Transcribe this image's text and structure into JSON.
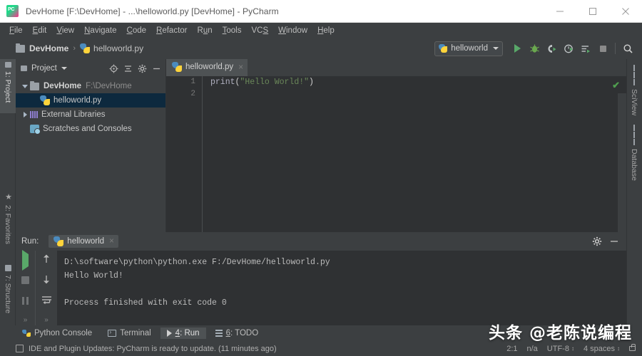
{
  "window": {
    "title": "DevHome [F:\\DevHome] - ...\\helloworld.py [DevHome] - PyCharm",
    "logo_icon": "pycharm-logo-icon",
    "minimize_icon": "minimize-icon",
    "maximize_icon": "maximize-icon",
    "close_icon": "close-icon"
  },
  "menubar": {
    "items": [
      {
        "label": "File",
        "mnemonic": "F"
      },
      {
        "label": "Edit",
        "mnemonic": "E"
      },
      {
        "label": "View",
        "mnemonic": "V"
      },
      {
        "label": "Navigate",
        "mnemonic": "N"
      },
      {
        "label": "Code",
        "mnemonic": "C"
      },
      {
        "label": "Refactor",
        "mnemonic": "R"
      },
      {
        "label": "Run",
        "mnemonic": "u"
      },
      {
        "label": "Tools",
        "mnemonic": "T"
      },
      {
        "label": "VCS",
        "mnemonic": "S"
      },
      {
        "label": "Window",
        "mnemonic": "W"
      },
      {
        "label": "Help",
        "mnemonic": "H"
      }
    ]
  },
  "navbar": {
    "breadcrumb": [
      {
        "label": "DevHome",
        "icon": "folder-icon"
      },
      {
        "label": "helloworld.py",
        "icon": "python-file-icon"
      }
    ],
    "separator": "›",
    "run_config": {
      "label": "helloworld",
      "icon": "python-file-icon",
      "caret": "chevron-down-icon"
    },
    "buttons": [
      {
        "name": "run-button",
        "icon": "run-triangle-icon"
      },
      {
        "name": "debug-button",
        "icon": "bug-icon"
      },
      {
        "name": "run-with-coverage-button",
        "icon": "coverage-icon"
      },
      {
        "name": "profile-button",
        "icon": "profile-clock-icon"
      },
      {
        "name": "run-with-console-button",
        "icon": "run-console-icon"
      },
      {
        "name": "stop-button",
        "icon": "stop-square-icon"
      },
      {
        "name": "search-everywhere-button",
        "icon": "search-icon"
      }
    ]
  },
  "left_strip": {
    "tabs": [
      {
        "label": "1: Project",
        "icon": "project-icon",
        "active": true
      },
      {
        "label": "2: Favorites",
        "icon": "star-icon",
        "active": false
      },
      {
        "label": "7: Structure",
        "icon": "structure-icon",
        "active": false
      }
    ]
  },
  "right_strip": {
    "tabs": [
      {
        "label": "SciView",
        "icon": "sciview-icon"
      },
      {
        "label": "Database",
        "icon": "database-icon"
      }
    ]
  },
  "project_panel": {
    "title": "Project",
    "title_caret": "chevron-down-icon",
    "header_icons": [
      {
        "name": "locate-icon"
      },
      {
        "name": "collapse-all-icon"
      },
      {
        "name": "settings-gear-icon"
      },
      {
        "name": "hide-icon"
      }
    ],
    "tree": [
      {
        "label": "DevHome",
        "detail": "F:\\DevHome",
        "icon": "folder-icon",
        "twisty": "expanded",
        "bold": true,
        "selected": false
      },
      {
        "label": "helloworld.py",
        "detail": "",
        "icon": "python-file-icon",
        "twisty": "none",
        "bold": false,
        "selected": true
      },
      {
        "label": "External Libraries",
        "detail": "",
        "icon": "library-icon",
        "twisty": "collapsed",
        "bold": false,
        "selected": false
      },
      {
        "label": "Scratches and Consoles",
        "detail": "",
        "icon": "scratches-icon",
        "twisty": "none",
        "bold": false,
        "selected": false
      }
    ]
  },
  "editor": {
    "tab": {
      "label": "helloworld.py",
      "icon": "python-file-icon",
      "close": "×"
    },
    "line_numbers": [
      "1",
      "2"
    ],
    "code": {
      "function": "print",
      "open_paren": "(",
      "string": "\"Hello World!\"",
      "close_paren": ")"
    },
    "inspection_status_icon": "green-check-icon",
    "inspection_status": "✔"
  },
  "run_panel": {
    "label": "Run:",
    "tab": {
      "label": "helloworld",
      "icon": "python-run-icon",
      "close": "×"
    },
    "header_icons": [
      {
        "name": "settings-gear-icon"
      },
      {
        "name": "hide-panel-icon"
      }
    ],
    "tool_buttons": [
      {
        "name": "rerun-button",
        "icon": "run-triangle-icon"
      },
      {
        "name": "stop-button",
        "icon": "stop-square-icon"
      },
      {
        "name": "pause-button",
        "icon": "pause-icon"
      },
      {
        "name": "more-button",
        "icon": "chevrons-right-icon"
      }
    ],
    "tool_buttons2": [
      {
        "name": "up-arrow-button",
        "icon": "arrow-up-icon"
      },
      {
        "name": "down-arrow-button",
        "icon": "arrow-down-icon"
      },
      {
        "name": "soft-wrap-button",
        "icon": "soft-wrap-icon"
      },
      {
        "name": "more-button-2",
        "icon": "chevrons-right-icon"
      }
    ],
    "console": {
      "command": "D:\\software\\python\\python.exe F:/DevHome/helloworld.py",
      "output": "Hello World!",
      "exit_message": "Process finished with exit code 0"
    }
  },
  "bottom_tabs": [
    {
      "label": "Python Console",
      "icon": "python-console-icon",
      "active": false,
      "mnemonic": ""
    },
    {
      "label": "Terminal",
      "icon": "terminal-icon",
      "active": false,
      "mnemonic": ""
    },
    {
      "label": "4: Run",
      "icon": "run-triangle-icon",
      "active": true,
      "mnemonic": "4"
    },
    {
      "label": "6: TODO",
      "icon": "todo-list-icon",
      "active": false,
      "mnemonic": "6"
    }
  ],
  "statusbar": {
    "icon": "notification-icon",
    "message": "IDE and Plugin Updates: PyCharm is ready to update. (11 minutes ago)",
    "caret_position": "2:1",
    "line_separator": "n/a",
    "encoding": "UTF-8",
    "indent": "4 spaces",
    "lock_icon": "lock-icon"
  },
  "watermark": {
    "text": "头条 @老陈说编程"
  },
  "colors": {
    "titlebar_bg": "#ffffff",
    "chrome_bg": "#3c3f41",
    "editor_bg": "#2f3133",
    "selection_bg": "#0d293e",
    "accent_green": "#59a869",
    "string_green": "#6a8759",
    "active_tab_bg": "#4e5254"
  }
}
